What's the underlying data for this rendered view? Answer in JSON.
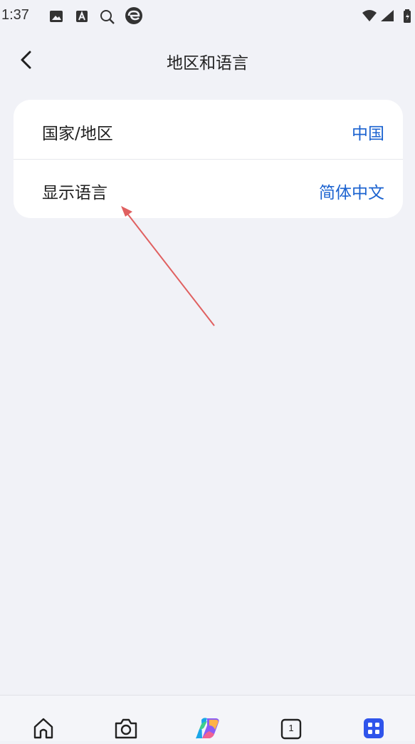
{
  "status_bar": {
    "time": "1:37",
    "icons": [
      "image-icon",
      "a-badge-icon",
      "search-icon",
      "edge-browser-icon"
    ],
    "right_icons": [
      "wifi-icon",
      "signal-icon",
      "battery-icon"
    ]
  },
  "header": {
    "title": "地区和语言",
    "back_icon": "chevron-left-icon"
  },
  "settings": {
    "items": [
      {
        "label": "国家/地区",
        "value": "中国"
      },
      {
        "label": "显示语言",
        "value": "简体中文"
      }
    ]
  },
  "bottom_nav": {
    "items": [
      "home-icon",
      "camera-icon",
      "copilot-icon",
      "tabs-icon",
      "apps-icon"
    ],
    "tab_count": "1"
  },
  "colors": {
    "background": "#f1f2f7",
    "card": "#ffffff",
    "accent": "#1c63d0",
    "annotation": "#e06060",
    "active_nav": "#2f54eb"
  }
}
